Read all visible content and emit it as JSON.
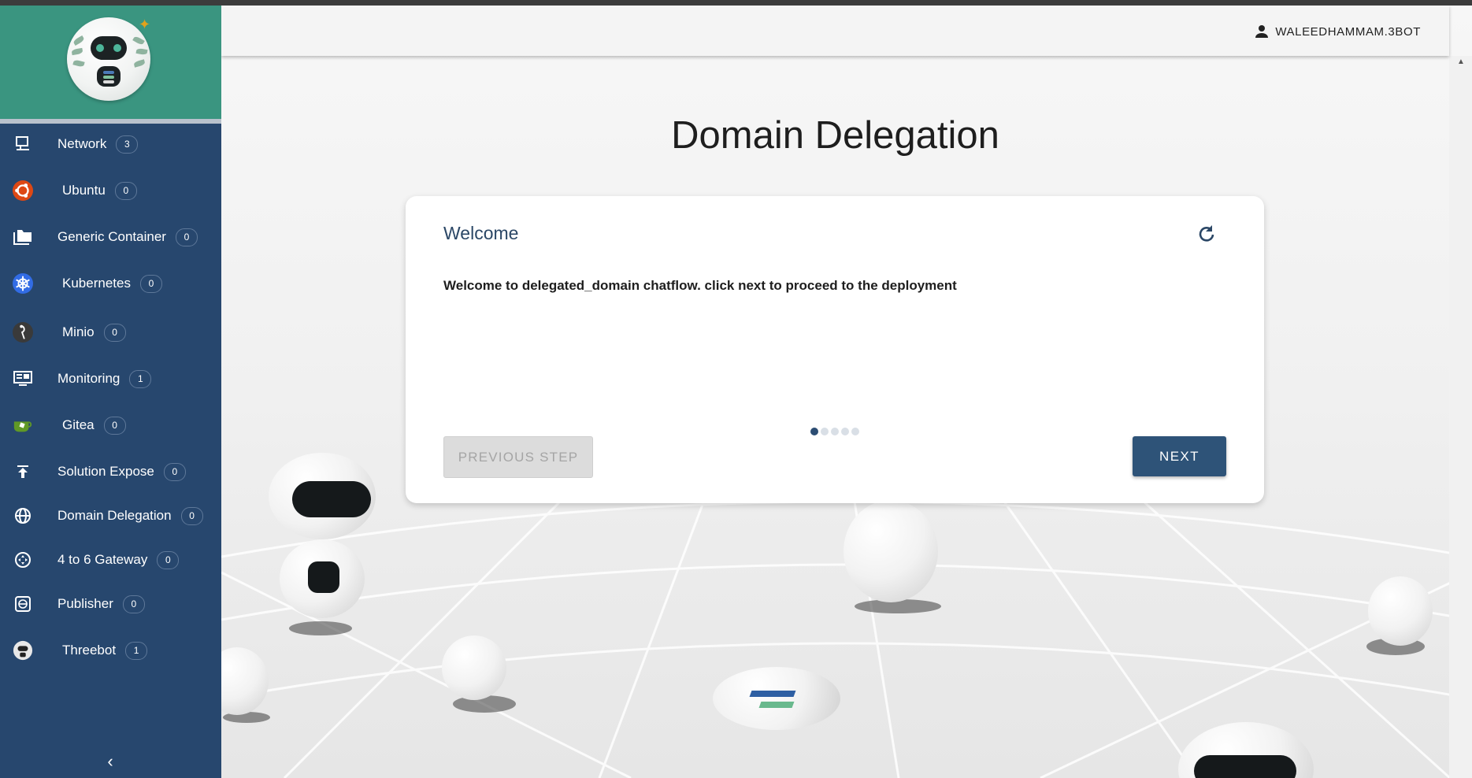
{
  "sidebar": {
    "items": [
      {
        "label": "Network",
        "count": "3",
        "icon": "monitor-icon"
      },
      {
        "label": "Ubuntu",
        "count": "0",
        "icon": "ubuntu-icon"
      },
      {
        "label": "Generic Container",
        "count": "0",
        "icon": "folders-icon"
      },
      {
        "label": "Kubernetes",
        "count": "0",
        "icon": "kubernetes-icon"
      },
      {
        "label": "Minio",
        "count": "0",
        "icon": "minio-icon"
      },
      {
        "label": "Monitoring",
        "count": "1",
        "icon": "dashboard-monitor-icon"
      },
      {
        "label": "Gitea",
        "count": "0",
        "icon": "gitea-icon"
      },
      {
        "label": "Solution Expose",
        "count": "0",
        "icon": "upload-icon"
      },
      {
        "label": "Domain Delegation",
        "count": "0",
        "icon": "globe-icon"
      },
      {
        "label": "4 to 6 Gateway",
        "count": "0",
        "icon": "gateway-icon"
      },
      {
        "label": "Publisher",
        "count": "0",
        "icon": "publisher-icon"
      },
      {
        "label": "Threebot",
        "count": "1",
        "icon": "threebot-icon"
      }
    ],
    "collapse_icon": "chevron-left-icon"
  },
  "header": {
    "username": "WALEEDHAMMAM.3BOT",
    "user_icon": "person-icon"
  },
  "main": {
    "title": "Domain Delegation",
    "card": {
      "title": "Welcome",
      "message": "Welcome to delegated_domain chatflow. click next to proceed to the deployment",
      "prev_label": "PREVIOUS STEP",
      "next_label": "NEXT",
      "steps_total": 5,
      "current_step": 1,
      "refresh_icon": "refresh-icon"
    }
  },
  "colors": {
    "sidebar": "#27476e",
    "sidebar_header": "#3a9580",
    "primary_button": "#2e5378",
    "title_text": "#2b4766"
  }
}
